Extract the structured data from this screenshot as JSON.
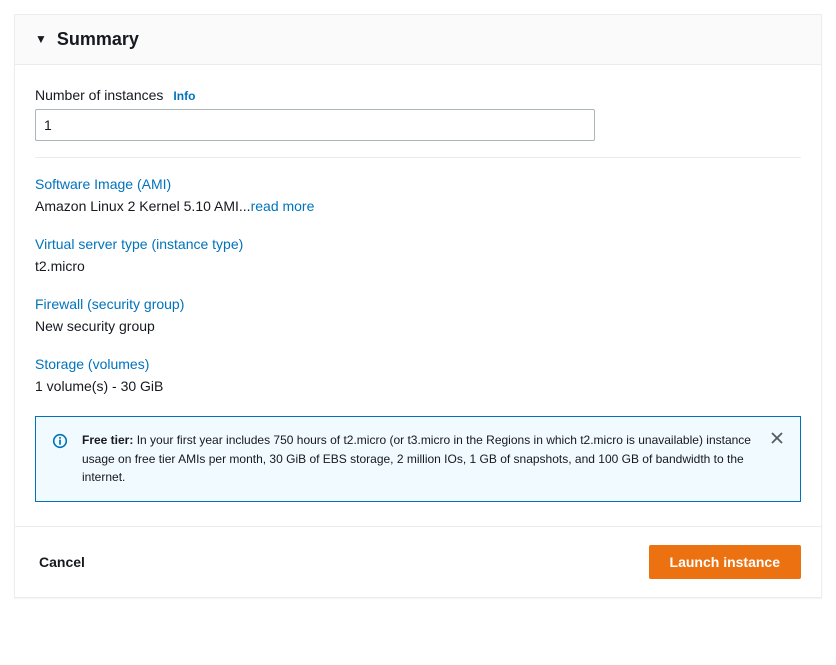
{
  "summary": {
    "title": "Summary",
    "number_of_instances": {
      "label": "Number of instances",
      "info_label": "Info",
      "value": "1"
    },
    "software_image": {
      "link_label": "Software Image (AMI)",
      "value_prefix": "Amazon Linux 2 Kernel 5.10 AMI...",
      "read_more_label": "read more"
    },
    "instance_type": {
      "link_label": "Virtual server type (instance type)",
      "value": "t2.micro"
    },
    "firewall": {
      "link_label": "Firewall (security group)",
      "value": "New security group"
    },
    "storage": {
      "link_label": "Storage (volumes)",
      "value": "1 volume(s) - 30 GiB"
    },
    "free_tier_alert": {
      "bold_label": "Free tier:",
      "body": " In your first year includes 750 hours of t2.micro (or t3.micro in the Regions in which t2.micro is unavailable) instance usage on free tier AMIs per month, 30 GiB of EBS storage, 2 million IOs, 1 GB of snapshots, and 100 GB of bandwidth to the internet."
    }
  },
  "footer": {
    "cancel_label": "Cancel",
    "launch_label": "Launch instance"
  }
}
